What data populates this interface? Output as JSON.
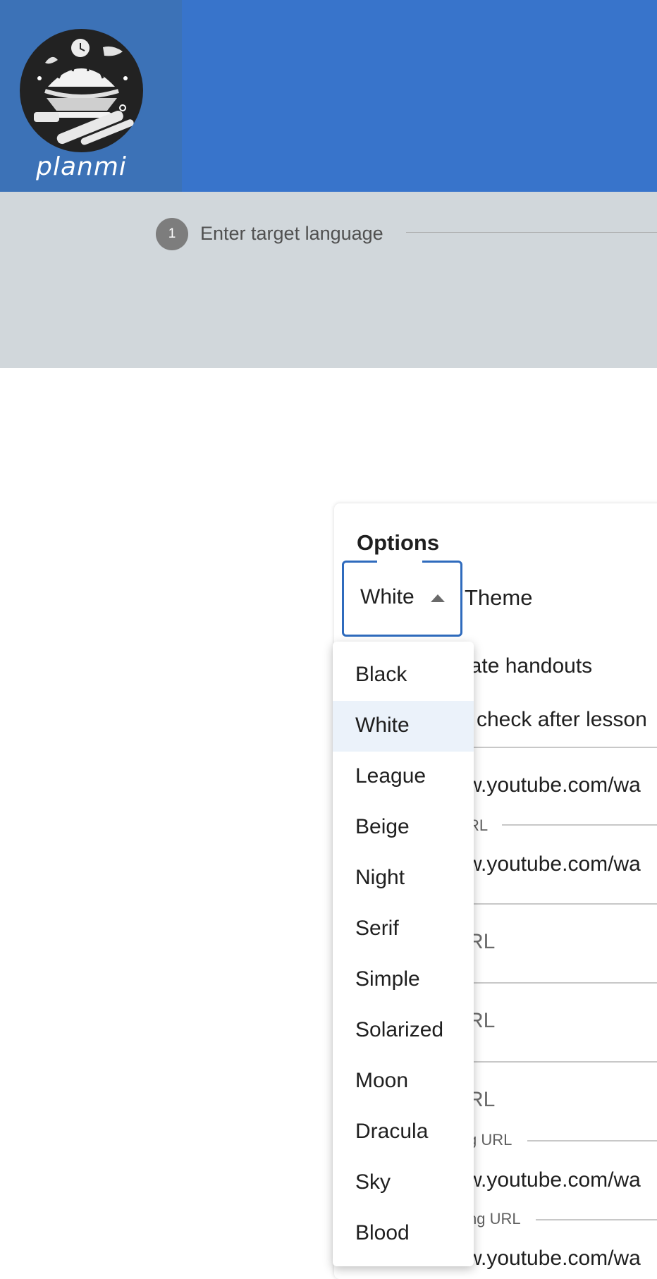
{
  "app": {
    "logo_text": "planmi"
  },
  "stepper": {
    "step_number": "1",
    "step_label": "Enter target language"
  },
  "options": {
    "title": "Options",
    "theme_select": {
      "value": "White",
      "label": "Theme"
    },
    "background_rows": [
      {
        "text": "erate handouts"
      },
      {
        "text": "check after lesson"
      },
      {
        "text": "w.youtube.com/wa"
      },
      {
        "text": "RL"
      },
      {
        "text": "w.youtube.com/wa"
      },
      {
        "text": "RL"
      },
      {
        "text": "RL"
      },
      {
        "text": "RL"
      },
      {
        "text": "g URL"
      },
      {
        "text": "w.youtube.com/wa"
      },
      {
        "text": "ng URL"
      },
      {
        "text": "w.youtube.com/wa"
      }
    ]
  },
  "theme_menu": {
    "selected": "White",
    "items": [
      "Black",
      "White",
      "League",
      "Beige",
      "Night",
      "Serif",
      "Simple",
      "Solarized",
      "Moon",
      "Dracula",
      "Sky",
      "Blood"
    ]
  },
  "colors": {
    "appbar": "#3874cb",
    "stepper_bg": "#d1d7db",
    "accent": "#2f6bbd",
    "selected_item": "#ebf2fa"
  }
}
